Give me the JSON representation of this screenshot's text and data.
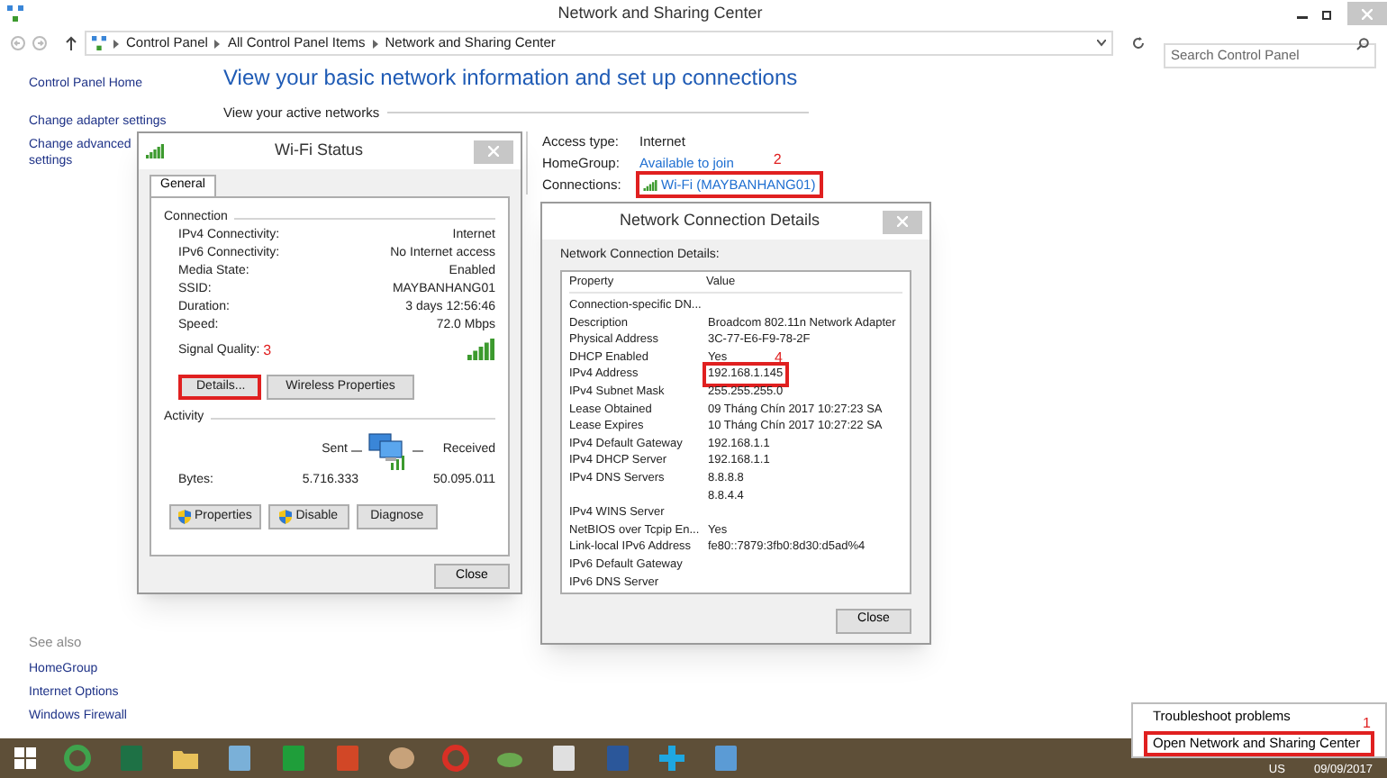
{
  "window": {
    "title": "Network and Sharing Center"
  },
  "breadcrumb": [
    "Control Panel",
    "All Control Panel Items",
    "Network and Sharing Center"
  ],
  "search": {
    "placeholder": "Search Control Panel"
  },
  "sidebar": {
    "items": [
      {
        "lines": [
          "Control Panel Home"
        ]
      },
      {
        "lines": [
          "Change adapter settings"
        ]
      },
      {
        "lines": [
          "Change advanced",
          "settings"
        ]
      }
    ],
    "see_also": {
      "title": "See also",
      "links": [
        "HomeGroup",
        "Internet Options",
        "Windows Firewall"
      ]
    }
  },
  "heading": "View your basic network information and set up connections",
  "active_networks": {
    "title": "View your active networks",
    "rows": [
      {
        "label": "Access type:",
        "value": "Internet",
        "kind": "text"
      },
      {
        "label": "HomeGroup:",
        "value": "Available to join",
        "kind": "link",
        "marker": "2"
      },
      {
        "label": "Connections:",
        "value": "Wi-Fi (MAYBANHANG01)",
        "kind": "connection",
        "highlighted": true
      }
    ]
  },
  "wifi_status": {
    "title": "Wi-Fi Status",
    "tabs": [
      {
        "label": "General",
        "selected": true
      }
    ],
    "connection": {
      "title": "Connection",
      "rows": [
        {
          "label": "IPv4 Connectivity:",
          "value": "Internet"
        },
        {
          "label": "IPv6 Connectivity:",
          "value": "No Internet access"
        },
        {
          "label": "Media State:",
          "value": "Enabled"
        },
        {
          "label": "SSID:",
          "value": "MAYBANHANG01"
        },
        {
          "label": "Duration:",
          "value": "3 days 12:56:46"
        },
        {
          "label": "Speed:",
          "value": "72.0 Mbps"
        }
      ],
      "signal_label": "Signal Quality:",
      "signal_marker": "3"
    },
    "buttons": [
      {
        "label": "Details...",
        "highlighted": true
      },
      {
        "label": "Wireless Properties",
        "highlighted": false
      }
    ],
    "activity": {
      "title": "Activity",
      "sent_label": "Sent",
      "received_label": "Received",
      "bytes_label": "Bytes:",
      "sent": "5.716.333",
      "received": "50.095.011"
    },
    "actions": [
      {
        "label": "Properties",
        "shield": true
      },
      {
        "label": "Disable",
        "shield": true
      },
      {
        "label": "Diagnose",
        "shield": false
      }
    ],
    "close": "Close"
  },
  "details": {
    "title": "Network Connection Details",
    "caption": "Network Connection Details:",
    "columns": [
      "Property",
      "Value"
    ],
    "rows": [
      {
        "property": "Connection-specific DN..."
      },
      {
        "property": "Description",
        "value": "Broadcom 802.11n Network Adapter"
      },
      {
        "property": "Physical Address",
        "value": "3C-77-E6-F9-78-2F"
      },
      {
        "property": "DHCP Enabled",
        "value": "Yes",
        "marker": "4"
      },
      {
        "property": "IPv4 Address",
        "value": "192.168.1.145",
        "highlighted": true
      },
      {
        "property": "IPv4 Subnet Mask",
        "value": "255.255.255.0"
      },
      {
        "property": "Lease Obtained",
        "value": "09 Tháng Chín 2017 10:27:23 SA"
      },
      {
        "property": "Lease Expires",
        "value": "10 Tháng Chín 2017 10:27:22 SA"
      },
      {
        "property": "IPv4 Default Gateway",
        "value": "192.168.1.1"
      },
      {
        "property": "IPv4 DHCP Server",
        "value": "192.168.1.1"
      },
      {
        "property": "IPv4 DNS Servers",
        "value": "8.8.8.8"
      },
      {
        "value": "8.8.4.4"
      },
      {
        "property": "IPv4 WINS Server"
      },
      {
        "property": "NetBIOS over Tcpip En...",
        "value": "Yes"
      },
      {
        "property": "Link-local IPv6 Address",
        "value": "fe80::7879:3fb0:8d30:d5ad%4"
      },
      {
        "property": "IPv6 Default Gateway"
      },
      {
        "property": "IPv6 DNS Server"
      }
    ],
    "close": "Close"
  },
  "tray_menu": {
    "items": [
      {
        "label": "Troubleshoot problems",
        "highlighted": false
      },
      {
        "label": "Open Network and Sharing Center",
        "highlighted": true,
        "marker": "1"
      }
    ]
  },
  "taskbar": {
    "apps": [
      {
        "kind": "ring",
        "color": "#3fa34d"
      },
      {
        "kind": "tile",
        "color": "#1e7145"
      },
      {
        "kind": "folder",
        "color": "#e8c15a"
      },
      {
        "kind": "tile",
        "color": "#7ab0d8"
      },
      {
        "kind": "tile",
        "color": "#1f9e3a"
      },
      {
        "kind": "tile",
        "color": "#d24726"
      },
      {
        "kind": "palette",
        "color": "#c7a27a"
      },
      {
        "kind": "ring",
        "color": "#d93025"
      },
      {
        "kind": "cloud",
        "color": "#6aa84f"
      },
      {
        "kind": "tile",
        "color": "#e0e0e0"
      },
      {
        "kind": "tile",
        "color": "#2b579a"
      },
      {
        "kind": "plus",
        "color": "#1ea7e1"
      },
      {
        "kind": "tile",
        "color": "#5b9bd5"
      }
    ],
    "language": "US",
    "date": "09/09/2017"
  }
}
